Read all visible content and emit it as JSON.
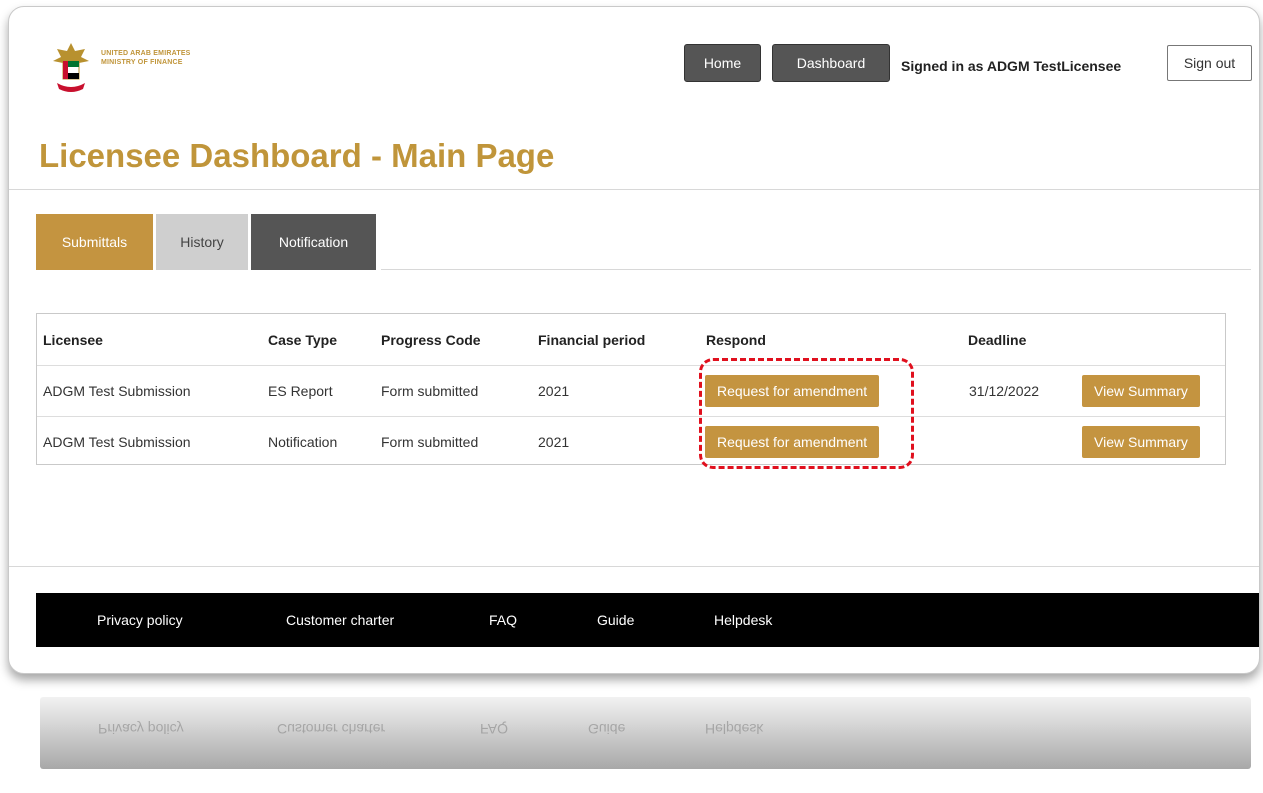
{
  "header": {
    "logo": {
      "line1": "UNITED ARAB EMIRATES",
      "line2": "MINISTRY OF FINANCE",
      "icon": "falcon-emblem-icon"
    },
    "nav": {
      "home_label": "Home",
      "dashboard_label": "Dashboard",
      "signed_in_text": "Signed in as ADGM TestLicensee",
      "signout_label": "Sign out"
    }
  },
  "page": {
    "title": "Licensee Dashboard - Main Page"
  },
  "tabs": [
    {
      "label": "Submittals"
    },
    {
      "label": "History"
    },
    {
      "label": "Notification"
    }
  ],
  "table": {
    "headers": [
      "Licensee",
      "Case Type",
      "Progress Code",
      "Financial period",
      "Respond",
      "Deadline"
    ],
    "rows": [
      {
        "licensee": "ADGM Test Submission",
        "case_type": "ES Report",
        "progress_code": "Form submitted",
        "financial_period": "2021",
        "respond": "Request for amendment",
        "deadline": "31/12/2022",
        "action": "View Summary"
      },
      {
        "licensee": "ADGM Test Submission",
        "case_type": "Notification",
        "progress_code": "Form submitted",
        "financial_period": "2021",
        "respond": "Request for amendment",
        "deadline": "",
        "action": "View Summary"
      }
    ]
  },
  "footer": {
    "links": [
      "Privacy policy",
      "Customer charter",
      "FAQ",
      "Guide",
      "Helpdesk"
    ]
  },
  "colors": {
    "accent_gold": "#c49440",
    "dark_button": "#555555",
    "highlight_red": "#e0101e"
  }
}
